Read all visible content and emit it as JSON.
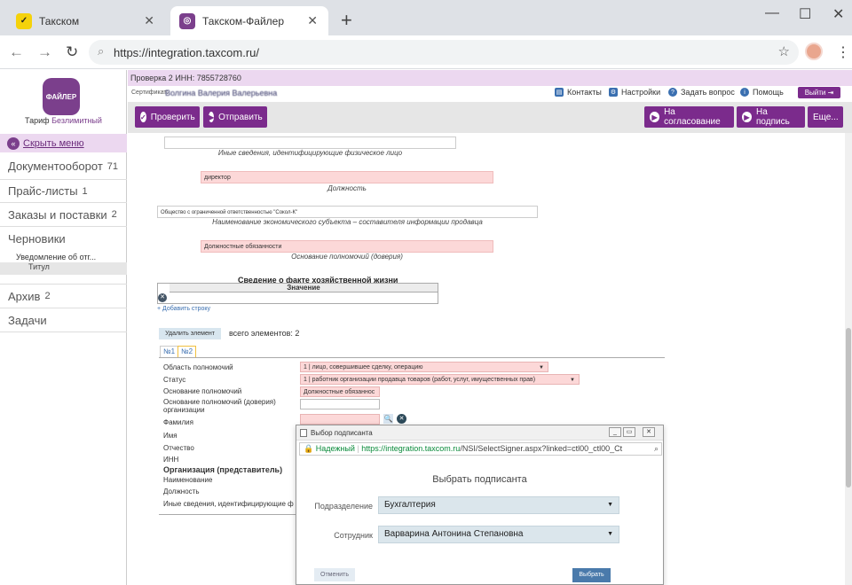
{
  "browser": {
    "tabs": [
      {
        "title": "Такском",
        "active": false
      },
      {
        "title": "Такском-Файлер",
        "active": true
      }
    ],
    "url": "https://integration.taxcom.ru/"
  },
  "sidebar": {
    "logo_text": "ФАЙЛЕР",
    "tariff_label": "Тариф",
    "tariff_value": "Безлимитный",
    "hide_menu": "Скрыть меню",
    "items": [
      {
        "label": "Документооборот",
        "count": "71"
      },
      {
        "label": "Прайс-листы",
        "count": "1"
      },
      {
        "label": "Заказы и поставки",
        "count": "2"
      },
      {
        "label": "Черновики",
        "count": ""
      },
      {
        "label": "Архив",
        "count": "2"
      },
      {
        "label": "Задачи",
        "count": ""
      }
    ],
    "sub_draft": "Уведомление об отг...",
    "sub_title": "Титул"
  },
  "header": {
    "inn_line": "Проверка 2 ИНН: 7855728760",
    "cert_label": "Сертификат:",
    "cert_value": "Волгина Валерия Валерьевна",
    "links": [
      "Контакты",
      "Настройки",
      "Задать вопрос",
      "Помощь"
    ],
    "exit": "Выйти"
  },
  "toolbar": {
    "check": "Проверить",
    "send": "Отправить",
    "approve": "На согласование",
    "sign": "На подпись",
    "more": "Еще..."
  },
  "form": {
    "other_info_caption": "Иные сведения, идентифицирующие физическое лицо",
    "position_value": "директор",
    "position_caption": "Должность",
    "org_value": "Общество с ограниченной ответственностью \"Сокол-К\"",
    "org_caption": "Наименование экономического субъекта – составителя информации продавца",
    "basis_value": "Должностные обязанности",
    "basis_caption": "Основание полномочий (доверия)",
    "fact_title": "Сведение о факте хозяйственной жизни",
    "fact_column": "Значение",
    "add_row": "+ Добавить строку",
    "delete_element": "Удалить элемент",
    "total": "всего элементов: 2",
    "tab1": "№1",
    "tab2": "№2",
    "fields": [
      "Область полномочий",
      "Статус",
      "Основание полномочий",
      "Основание полномочий (доверия)",
      "организации",
      "Фамилия",
      "Имя",
      "Отчество",
      "ИНН",
      "Организация (представитель)",
      "Наименование",
      "Должность",
      "Иные сведения, идентифицирующие ф"
    ],
    "scope_value": "1 | лицо, совершившее сделку, операцию",
    "status_value": "1 | работник организации продавца товаров (работ, услуг, имущественных прав)",
    "basis2_value": "Должностные обязаннос"
  },
  "popup": {
    "window_title": "Выбор подписанта",
    "secure": "Надежный",
    "url_host": "https://integration.taxcom.ru",
    "url_rest": "/NSI/SelectSigner.aspx?linked=ctl00_ctl00_Ct",
    "heading": "Выбрать подписанта",
    "dept_label": "Подразделение",
    "dept_value": "Бухгалтерия",
    "employee_label": "Сотрудник",
    "employee_value": "Варварина Антонина Степановна",
    "cancel": "Отменить",
    "select": "Выбрать"
  },
  "colors": {
    "brand": "#7b2b8c",
    "pink_field": "#fcd8d8",
    "select_bg": "#dbe6ec",
    "select_button": "#4a7aab"
  }
}
